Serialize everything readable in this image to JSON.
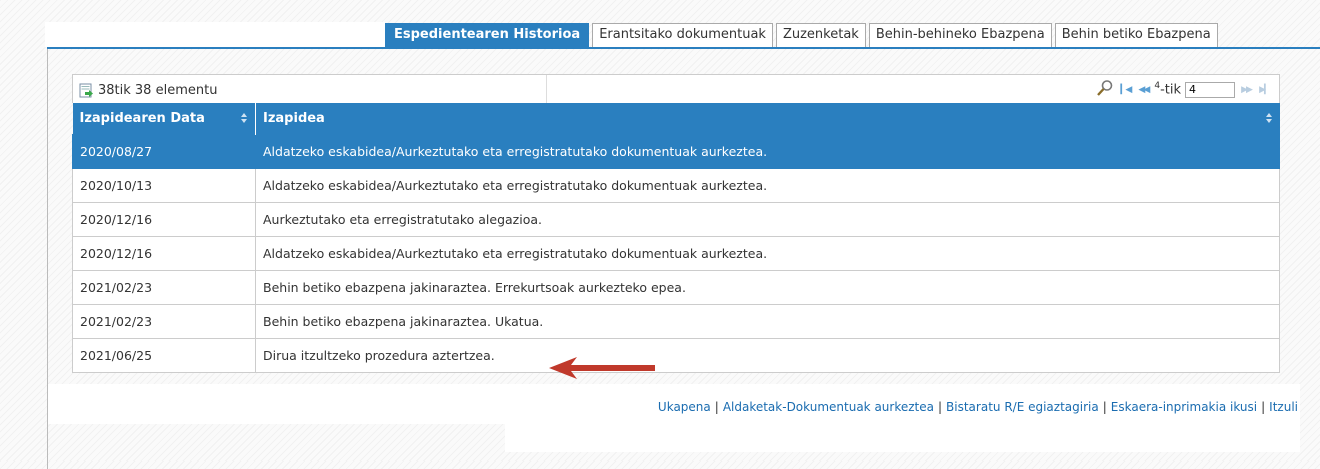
{
  "tabs": [
    {
      "label": "Espedientearen Historioa",
      "active": true
    },
    {
      "label": "Erantsitako dokumentuak",
      "active": false
    },
    {
      "label": "Zuzenketak",
      "active": false
    },
    {
      "label": "Behin-behineko Ebazpena",
      "active": false
    },
    {
      "label": "Behin betiko Ebazpena",
      "active": false
    }
  ],
  "toolbar": {
    "export_icon": "excel-export-icon",
    "count_label": "38tik 38 elementu",
    "search_icon": "magnifier-icon",
    "first_icon": "first-page-icon",
    "prev_icon": "prev-page-icon",
    "next_icon": "next-page-icon",
    "last_icon": "last-page-icon",
    "pages_sup": "4",
    "pages_suffix": "-tik",
    "page_value": "4"
  },
  "table": {
    "columns": [
      "Izapidearen Data",
      "Izapidea"
    ],
    "rows": [
      {
        "date": "2020/08/27",
        "desc": "Aldatzeko eskabidea/Aurkeztutako eta erregistratutako dokumentuak aurkeztea.",
        "selected": true
      },
      {
        "date": "2020/10/13",
        "desc": "Aldatzeko eskabidea/Aurkeztutako eta erregistratutako dokumentuak aurkeztea.",
        "selected": false
      },
      {
        "date": "2020/12/16",
        "desc": "Aurkeztutako eta erregistratutako alegazioa.",
        "selected": false
      },
      {
        "date": "2020/12/16",
        "desc": "Aldatzeko eskabidea/Aurkeztutako eta erregistratutako dokumentuak aurkeztea.",
        "selected": false
      },
      {
        "date": "2021/02/23",
        "desc": "Behin betiko ebazpena jakinaraztea. Errekurtsoak aurkezteko epea.",
        "selected": false
      },
      {
        "date": "2021/02/23",
        "desc": "Behin betiko ebazpena jakinaraztea. Ukatua.",
        "selected": false
      },
      {
        "date": "2021/06/25",
        "desc": "Dirua itzultzeko prozedura aztertzea.",
        "selected": false
      }
    ]
  },
  "links": [
    "Ukapena",
    "Aldaketak-Dokumentuak aurkeztea",
    "Bistaratu R/E egiaztagiria",
    "Eskaera-inprimakia ikusi",
    "Itzuli"
  ],
  "colors": {
    "accent": "#2a7fbf",
    "arrow": "#c0392b"
  }
}
